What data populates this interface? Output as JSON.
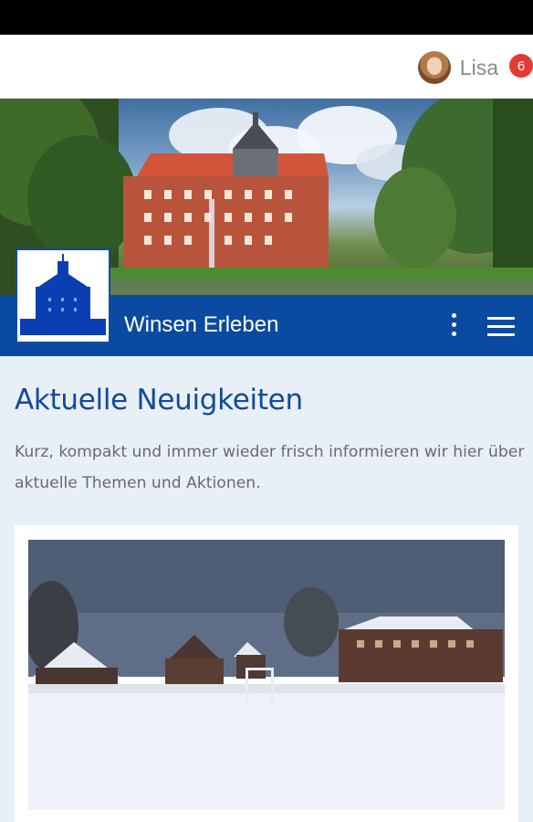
{
  "header": {
    "user_name": "Lisa",
    "notification_count": "6"
  },
  "brand": {
    "title": "Winsen Erleben",
    "accent_color": "#0a4aa0"
  },
  "icons": {
    "menu_more": "more-vert-icon",
    "menu_main": "hamburger-icon"
  },
  "news": {
    "heading": "Aktuelle Neuigkeiten",
    "lead": "Kurz, kompakt und immer wieder frisch informieren wir hier über aktuelle Themen und Aktionen."
  }
}
